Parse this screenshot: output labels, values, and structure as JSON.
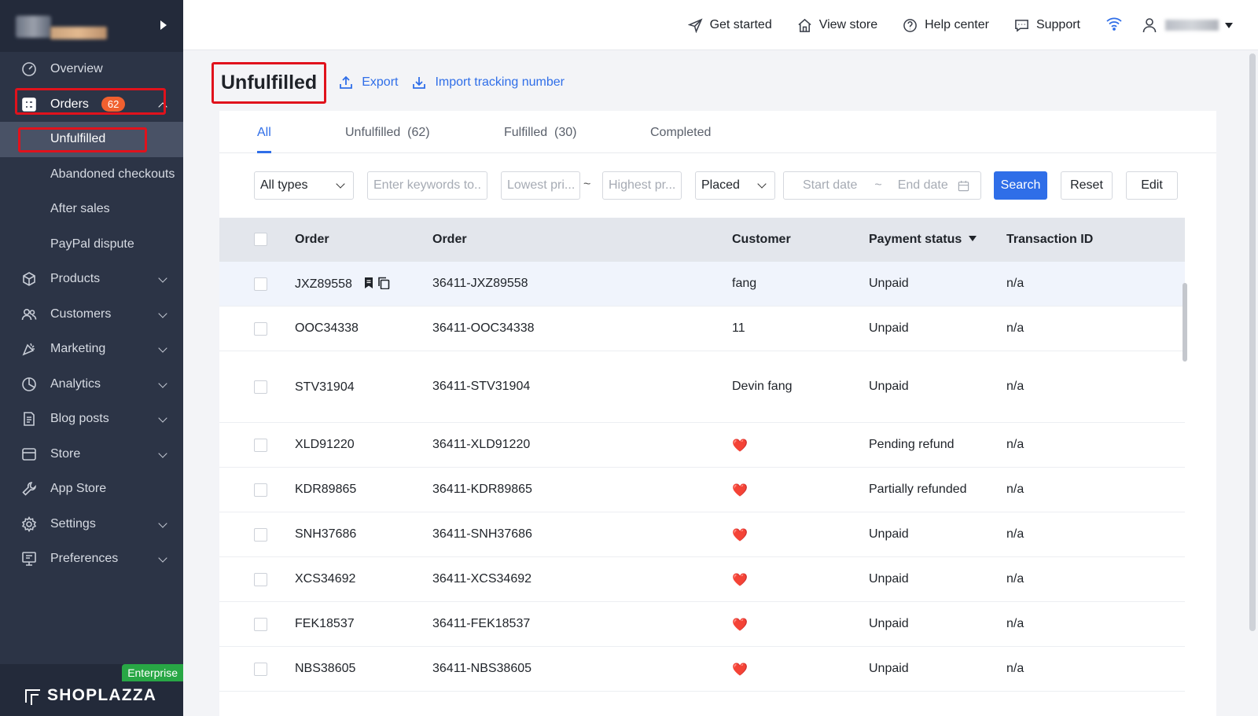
{
  "sidebar": {
    "items": [
      {
        "key": "overview",
        "label": "Overview",
        "icon": "gauge-icon"
      },
      {
        "key": "orders",
        "label": "Orders",
        "icon": "orders-icon",
        "badge": "62"
      },
      {
        "key": "products",
        "label": "Products",
        "icon": "box-icon"
      },
      {
        "key": "customers",
        "label": "Customers",
        "icon": "users-icon"
      },
      {
        "key": "marketing",
        "label": "Marketing",
        "icon": "megaphone-icon"
      },
      {
        "key": "analytics",
        "label": "Analytics",
        "icon": "pie-chart-icon"
      },
      {
        "key": "blog",
        "label": "Blog posts",
        "icon": "document-icon"
      },
      {
        "key": "store",
        "label": "Store",
        "icon": "storefront-icon"
      },
      {
        "key": "appstore",
        "label": "App Store",
        "icon": "wrench-icon"
      },
      {
        "key": "settings",
        "label": "Settings",
        "icon": "gear-icon"
      },
      {
        "key": "preferences",
        "label": "Preferences",
        "icon": "monitor-icon"
      }
    ],
    "orders_sub": [
      "Unfulfilled",
      "Abandoned checkouts",
      "After sales",
      "PayPal dispute"
    ],
    "enterprise": "Enterprise",
    "brand": "SHOPLAZZA"
  },
  "header": {
    "get_started": "Get started",
    "view_store": "View store",
    "help_center": "Help center",
    "support": "Support"
  },
  "page": {
    "title": "Unfulfilled",
    "export": "Export",
    "import": "Import tracking number"
  },
  "tabs": [
    "All",
    "Unfulfilled  (62)",
    "Fulfilled  (30)",
    "Completed"
  ],
  "filters": {
    "type": "All types",
    "keywords_ph": "Enter keywords to...",
    "lowest_ph": "Lowest pri...",
    "highest_ph": "Highest pr...",
    "tilde": "~",
    "placed": "Placed",
    "start_date": "Start date",
    "end_date": "End date",
    "search": "Search",
    "reset": "Reset",
    "edit": "Edit"
  },
  "table": {
    "headers": [
      "Order",
      "Order",
      "Customer",
      "Payment status",
      "Transaction ID"
    ],
    "rows": [
      {
        "order": "JXZ89558",
        "order_no": "36411-JXZ89558",
        "customer": "fang",
        "payment": "Unpaid",
        "txn": "n/a"
      },
      {
        "order": "OOC34338",
        "order_no": "36411-OOC34338",
        "customer": "11",
        "payment": "Unpaid",
        "txn": "n/a"
      },
      {
        "order": "STV31904",
        "order_no": "36411-STV31904",
        "customer": "Devin fang",
        "payment": "Unpaid",
        "txn": "n/a"
      },
      {
        "order": "XLD91220",
        "order_no": "36411-XLD91220",
        "customer": "❤️",
        "payment": "Pending refund",
        "txn": "n/a"
      },
      {
        "order": "KDR89865",
        "order_no": "36411-KDR89865",
        "customer": "❤️",
        "payment": "Partially refunded",
        "txn": "n/a"
      },
      {
        "order": "SNH37686",
        "order_no": "36411-SNH37686",
        "customer": "❤️",
        "payment": "Unpaid",
        "txn": "n/a"
      },
      {
        "order": "XCS34692",
        "order_no": "36411-XCS34692",
        "customer": "❤️",
        "payment": "Unpaid",
        "txn": "n/a"
      },
      {
        "order": "FEK18537",
        "order_no": "36411-FEK18537",
        "customer": "❤️",
        "payment": "Unpaid",
        "txn": "n/a"
      },
      {
        "order": "NBS38605",
        "order_no": "36411-NBS38605",
        "customer": "❤️",
        "payment": "Unpaid",
        "txn": "n/a"
      }
    ]
  },
  "colors": {
    "accent": "#2f6ee8",
    "sidebar": "#2c3446",
    "badge": "#f0602f",
    "highlight": "#e0121c",
    "enterprise": "#28a745"
  }
}
